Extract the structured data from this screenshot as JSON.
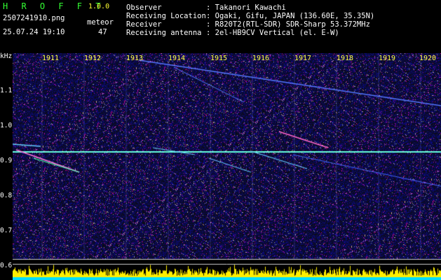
{
  "app": {
    "title": "H R O F F T",
    "version": "1.0.0"
  },
  "file": {
    "name": "2507241910.png",
    "datetime": "25.07.24 19:10"
  },
  "meteor": {
    "label": "meteor",
    "count": "47"
  },
  "info": [
    {
      "label": "Observer",
      "value": ": Takanori Kawachi"
    },
    {
      "label": "Receiving Location",
      "value": ": Ogaki, Gifu, JAPAN (136.60E, 35.35N)"
    },
    {
      "label": "Receiver",
      "value": ": R820T2(RTL-SDR) SDR-Sharp 53.372MHz"
    },
    {
      "label": "Receiving antenna",
      "value": ": 2el-HB9CV Vertical (el. E-W)"
    }
  ],
  "axis": {
    "unit": "kHz",
    "y_ticks": [
      "1.1",
      "1.0",
      "0.9",
      "0.8",
      "0.7",
      "0.6"
    ],
    "x_ticks": [
      "1911",
      "1912",
      "1913",
      "1914",
      "1915",
      "1916",
      "1917",
      "1918",
      "1919",
      "1920"
    ]
  },
  "colors": {
    "background": "#000000",
    "noise": "#1a1a8c",
    "carrier": "#55ffcc",
    "meteor": "#ff66cc",
    "level": "#ffee00",
    "axis_text": "#ffff44"
  }
}
